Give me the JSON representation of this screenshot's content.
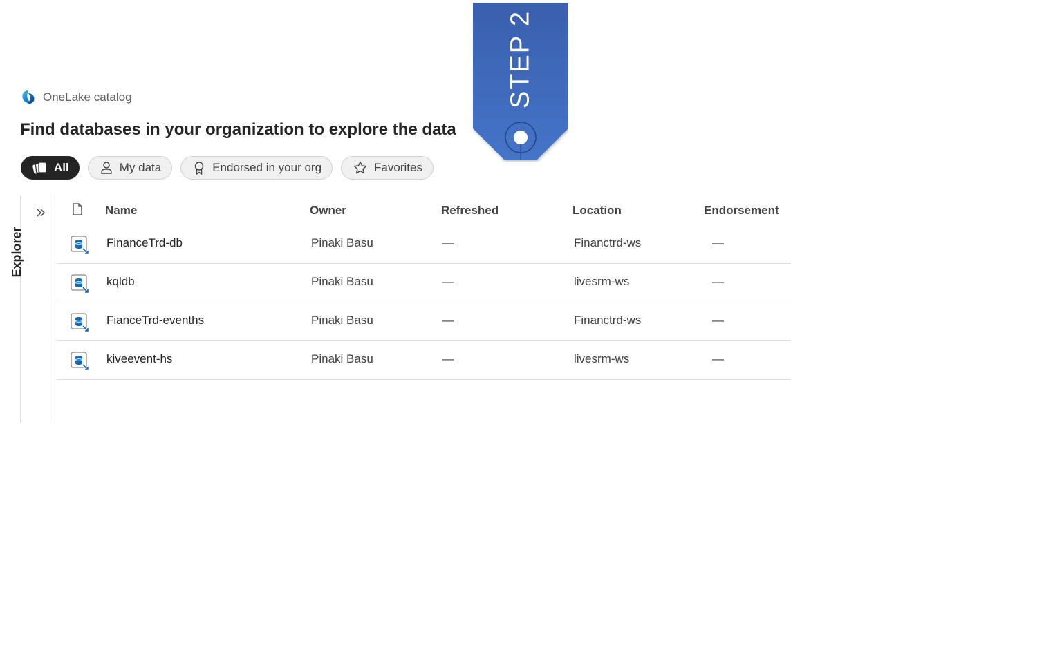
{
  "brand": {
    "name": "OneLake catalog"
  },
  "headline": "Find databases in your organization to explore the data",
  "filters": [
    {
      "label": "All",
      "icon": "stack-icon",
      "active": true
    },
    {
      "label": "My data",
      "icon": "person-icon",
      "active": false
    },
    {
      "label": "Endorsed in your org",
      "icon": "ribbon-icon",
      "active": false
    },
    {
      "label": "Favorites",
      "icon": "star-icon",
      "active": false
    }
  ],
  "explorer": {
    "label": "Explorer",
    "expand_icon": "chevron-double-right-icon"
  },
  "table": {
    "header_icon": "document-icon",
    "columns": [
      "Name",
      "Owner",
      "Refreshed",
      "Location",
      "Endorsement"
    ],
    "rows": [
      {
        "name": "FinanceTrd-db",
        "owner": "Pinaki Basu",
        "refreshed": "—",
        "location": "Financtrd-ws",
        "endorsement": "—",
        "icon": "kql-database-icon"
      },
      {
        "name": "kqldb",
        "owner": "Pinaki Basu",
        "refreshed": "—",
        "location": "livesrm-ws",
        "endorsement": "—",
        "icon": "kql-database-icon"
      },
      {
        "name": "FianceTrd-evenths",
        "owner": "Pinaki Basu",
        "refreshed": "—",
        "location": "Financtrd-ws",
        "endorsement": "—",
        "icon": "kql-database-icon"
      },
      {
        "name": "kiveevent-hs",
        "owner": "Pinaki Basu",
        "refreshed": "—",
        "location": "livesrm-ws",
        "endorsement": "—",
        "icon": "kql-database-icon"
      }
    ]
  },
  "step_tag": {
    "text": "STEP 2",
    "color": "#3b63b4"
  },
  "colors": {
    "chip_active_bg": "#242424",
    "chip_bg": "#f0f0f0",
    "divider": "#e0e0e0",
    "icon_blue": "#0f6cbd"
  }
}
